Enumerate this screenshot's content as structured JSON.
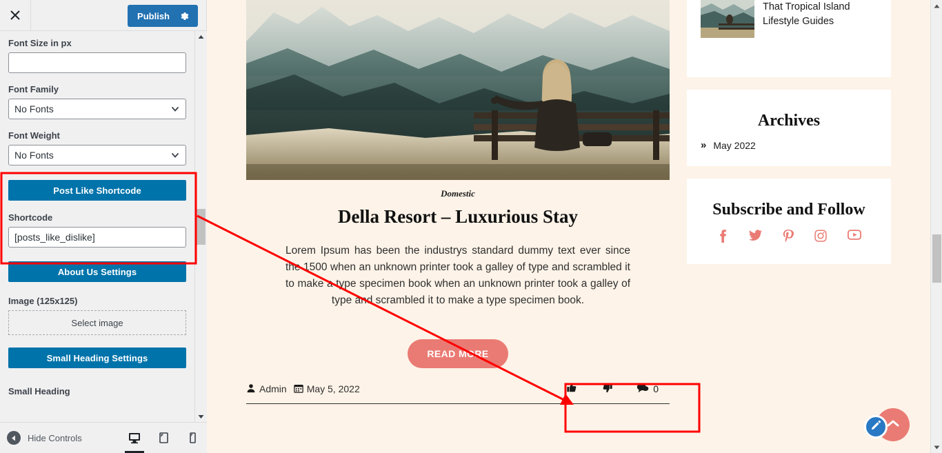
{
  "customizer": {
    "close_label": "×",
    "publish_label": "Publish",
    "gear_icon": "gear-icon",
    "fields": {
      "font_size_label": "Font Size in px",
      "font_size_value": "",
      "font_size_placeholder": "",
      "font_family_label": "Font Family",
      "font_family_value": "No Fonts",
      "font_weight_label": "Font Weight",
      "font_weight_value": "No Fonts",
      "shortcode_label": "Shortcode",
      "shortcode_value": "[posts_like_dislike]",
      "image_label": "Image (125x125)",
      "select_image_label": "Select image",
      "small_heading_label": "Small Heading"
    },
    "buttons": {
      "post_like_shortcode": "Post Like Shortcode",
      "about_us_settings": "About Us Settings",
      "small_heading_settings": "Small Heading Settings"
    },
    "footer": {
      "hide_controls_label": "Hide Controls",
      "devices": [
        "desktop-icon",
        "tablet-icon",
        "mobile-icon"
      ],
      "active_device": "desktop-icon"
    }
  },
  "preview": {
    "post": {
      "category": "Domestic",
      "title": "Della Resort – Luxurious Stay",
      "excerpt": "Lorem Ipsum has been the industrys standard dummy text ever since the 1500 when an unknown printer took a galley of type and scrambled it to make a type specimen book when an unknown printer took a galley of type and scrambled it to make a type specimen book.",
      "read_more_label": "READ MORE",
      "author": "Admin",
      "date": "May 5, 2022",
      "comment_count": "0",
      "like_icon": "thumbs-up-icon",
      "dislike_icon": "thumbs-down-icon",
      "comment_icon": "comment-icon",
      "image_alt": "woman sitting on bench overlooking mountains"
    },
    "widgets": {
      "recent": {
        "item_text": "That Tropical Island Lifestyle Guides"
      },
      "archives": {
        "title": "Archives",
        "items": [
          "May 2022"
        ]
      },
      "subscribe": {
        "title": "Subscribe and Follow",
        "socials": [
          "facebook-icon",
          "twitter-icon",
          "pinterest-icon",
          "instagram-icon",
          "youtube-icon"
        ]
      }
    },
    "fabs": {
      "scroll_top": "scroll-to-top-icon",
      "edit": "edit-pencil-icon"
    }
  },
  "colors": {
    "publish_blue": "#2271b1",
    "section_blue": "#0073aa",
    "accent_coral": "#ea7b74",
    "page_bg": "#fdf3e8",
    "annotation_red": "#ff0000"
  }
}
